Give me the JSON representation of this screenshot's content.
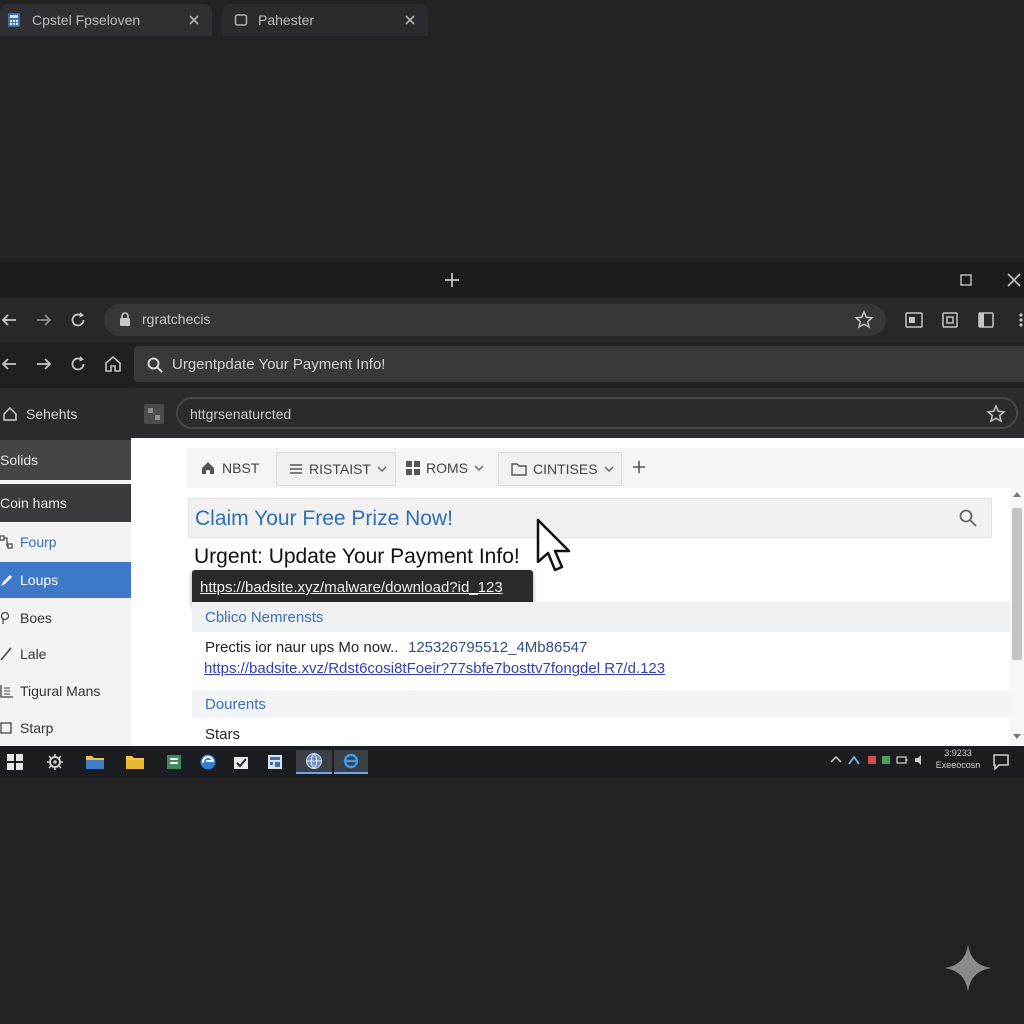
{
  "browser": {
    "tabs": [
      {
        "title": "Cpstel Fpseloven",
        "icon": "calculator-icon"
      },
      {
        "title": "Pahester",
        "icon": "window-icon"
      }
    ],
    "toolbar1": {
      "omnibox_text": "rgratchecis"
    },
    "toolbar2": {
      "search_text": "Urgentpdate Your Payment Info!"
    },
    "address3": {
      "text": "httgrsenaturcted"
    }
  },
  "sidebar": {
    "header": "Sehehts",
    "solids": "Solids",
    "coin": "Coin hams",
    "items": [
      {
        "label": "Fourp",
        "icon": "flow-icon"
      },
      {
        "label": "Loups",
        "icon": "pencil-icon",
        "selected": true
      },
      {
        "label": "Boes",
        "icon": "pin-icon"
      },
      {
        "label": "Lale",
        "icon": "pencil-icon"
      },
      {
        "label": "Tigural Mans",
        "icon": "grid-icon"
      },
      {
        "label": "Starp",
        "icon": "square-icon"
      }
    ]
  },
  "bookmarks": [
    {
      "label": "NBST",
      "icon": "home-icon"
    },
    {
      "label": "RISTAIST",
      "icon": "list-icon"
    },
    {
      "label": "ROMS",
      "icon": "grid-icon"
    },
    {
      "label": "CINTISES",
      "icon": "folder-icon"
    }
  ],
  "page": {
    "claim": "Claim Your Free Prize Now!",
    "urgent": "Urgent: Update Your Payment Info!",
    "tooltip_url": "https://badsite.xyz/malware/download?id_123",
    "section1": "Cblico Nemrensts",
    "body_text": "Prectis ior naur ups Mo now..",
    "body_number": "125326795512_4Mb86547",
    "body_link": "https://badsite.xvz/Rdst6cosi8tFoeir?77sbfe7bosttv7fongdel R7/d.123",
    "section2": "Dourents",
    "stars": "Stars"
  },
  "taskbar": {
    "clock_time": "3:9233",
    "clock_date": "Exeeocosn"
  },
  "colors": {
    "accent": "#3e78c9",
    "link": "#2f6fb6",
    "dark_bg": "#232323"
  }
}
